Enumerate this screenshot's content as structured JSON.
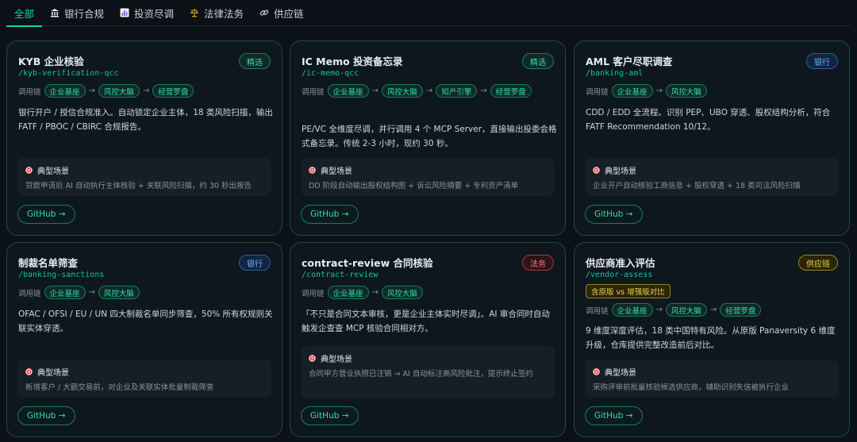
{
  "tabs": [
    {
      "label": "全部",
      "icon": ""
    },
    {
      "label": "银行合规",
      "icon": "bank-icon"
    },
    {
      "label": "投资尽调",
      "icon": "chart-icon"
    },
    {
      "label": "法律法务",
      "icon": "scales-icon"
    },
    {
      "label": "供应链",
      "icon": "link-icon"
    }
  ],
  "chain_label": "调用链",
  "scenario_label": "典型场景",
  "github_label": "GitHub →",
  "arrow": "→",
  "cards": [
    {
      "title": "KYB 企业核验",
      "badge": "精选",
      "slug": "/kyb-verification-qcc",
      "chain": [
        "企业基座",
        "风控大脑",
        "经营罗盘"
      ],
      "desc": "银行开户 / 授信合规准入。自动锁定企业主体，18 类风险扫描，输出 FATF / PBOC / CBIRC 合规报告。",
      "scenario": "贷款申请后 AI 自动执行主体核验 + 关联风险扫描，约 30 秒出报告"
    },
    {
      "title": "IC Memo 投资备忘录",
      "badge": "精选",
      "slug": "/ic-memo-qcc",
      "chain": [
        "企业基座",
        "风控大脑",
        "知产引擎",
        "经营罗盘"
      ],
      "desc": "PE/VC 全维度尽调，并行调用 4 个 MCP Server，直接输出投委会格式备忘录。传统 2-3 小时，现约 30 秒。",
      "scenario": "DD 阶段自动输出股权结构图 + 诉讼风险摘要 + 专利资产清单"
    },
    {
      "title": "AML 客户尽职调查",
      "badge": "银行",
      "slug": "/banking-aml",
      "chain": [
        "企业基座",
        "风控大脑"
      ],
      "desc": "CDD / EDD 全流程。识别 PEP、UBO 穿透、股权结构分析，符合 FATF Recommendation 10/12。",
      "scenario": "企业开户自动核验工商信息 + 股权穿透 + 18 类司法风险扫描"
    },
    {
      "title": "制裁名单筛查",
      "badge": "银行",
      "slug": "/banking-sanctions",
      "chain": [
        "企业基座",
        "风控大脑"
      ],
      "desc": "OFAC / OFSI / EU / UN 四大制裁名单同步筛查，50% 所有权规则关联实体穿透。",
      "scenario": "新增客户 / 大额交易前，对企业及关联实体批量制裁筛查"
    },
    {
      "title": "contract-review 合同核验",
      "badge": "法务",
      "slug": "/contract-review",
      "chain": [
        "企业基座",
        "风控大脑"
      ],
      "desc": "「不只是合同文本审核，更是企业主体实时尽调」。AI 审合同时自动触发企查查 MCP 核验合同相对方。",
      "scenario": "合同甲方营业执照已注销 → AI 自动标注高风险批注，提示终止签约"
    },
    {
      "title": "供应商准入评估",
      "badge": "供应链",
      "slug": "/vendor-assess",
      "compare": "含原版 vs 增强版对比",
      "chain": [
        "企业基座",
        "风控大脑",
        "经营罗盘"
      ],
      "desc": "9 维度深度评估，18 类中国特有风险。从原版 Panaversity 6 维度升级，仓库提供完整改造前后对比。",
      "scenario": "采购评审前批量核验候选供应商，辅助识别失信被执行企业"
    }
  ],
  "colors": {
    "accent": "#14d2a7",
    "background": "#0b1117",
    "card": "#0e171d"
  }
}
